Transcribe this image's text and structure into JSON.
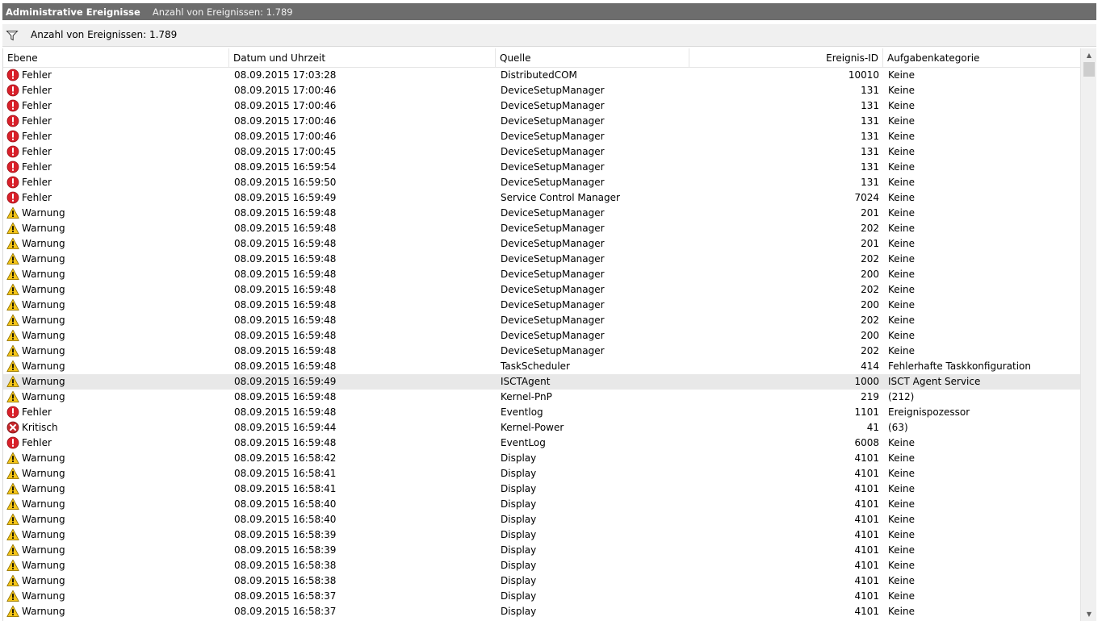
{
  "titlebar": {
    "title": "Administrative Ereignisse",
    "count": "Anzahl von Ereignissen: 1.789"
  },
  "filterbar": {
    "icon": "filter-funnel-icon",
    "text": "Anzahl von Ereignissen: 1.789"
  },
  "columns": {
    "level": "Ebene",
    "date": "Datum und Uhrzeit",
    "source": "Quelle",
    "id": "Ereignis-ID",
    "category": "Aufgabenkategorie"
  },
  "colors": {
    "error": "#d9202a",
    "warning": "#f5c518",
    "critical": "#c5282c",
    "title_band": "#6d6d6d",
    "selected_row": "#e8e8e8"
  },
  "rows": [
    {
      "level": "Fehler",
      "icon": "error",
      "date": "08.09.2015 17:03:28",
      "source": "DistributedCOM",
      "id": "10010",
      "category": "Keine"
    },
    {
      "level": "Fehler",
      "icon": "error",
      "date": "08.09.2015 17:00:46",
      "source": "DeviceSetupManager",
      "id": "131",
      "category": "Keine"
    },
    {
      "level": "Fehler",
      "icon": "error",
      "date": "08.09.2015 17:00:46",
      "source": "DeviceSetupManager",
      "id": "131",
      "category": "Keine"
    },
    {
      "level": "Fehler",
      "icon": "error",
      "date": "08.09.2015 17:00:46",
      "source": "DeviceSetupManager",
      "id": "131",
      "category": "Keine"
    },
    {
      "level": "Fehler",
      "icon": "error",
      "date": "08.09.2015 17:00:46",
      "source": "DeviceSetupManager",
      "id": "131",
      "category": "Keine"
    },
    {
      "level": "Fehler",
      "icon": "error",
      "date": "08.09.2015 17:00:45",
      "source": "DeviceSetupManager",
      "id": "131",
      "category": "Keine"
    },
    {
      "level": "Fehler",
      "icon": "error",
      "date": "08.09.2015 16:59:54",
      "source": "DeviceSetupManager",
      "id": "131",
      "category": "Keine"
    },
    {
      "level": "Fehler",
      "icon": "error",
      "date": "08.09.2015 16:59:50",
      "source": "DeviceSetupManager",
      "id": "131",
      "category": "Keine"
    },
    {
      "level": "Fehler",
      "icon": "error",
      "date": "08.09.2015 16:59:49",
      "source": "Service Control Manager",
      "id": "7024",
      "category": "Keine"
    },
    {
      "level": "Warnung",
      "icon": "warning",
      "date": "08.09.2015 16:59:48",
      "source": "DeviceSetupManager",
      "id": "201",
      "category": "Keine"
    },
    {
      "level": "Warnung",
      "icon": "warning",
      "date": "08.09.2015 16:59:48",
      "source": "DeviceSetupManager",
      "id": "202",
      "category": "Keine"
    },
    {
      "level": "Warnung",
      "icon": "warning",
      "date": "08.09.2015 16:59:48",
      "source": "DeviceSetupManager",
      "id": "201",
      "category": "Keine"
    },
    {
      "level": "Warnung",
      "icon": "warning",
      "date": "08.09.2015 16:59:48",
      "source": "DeviceSetupManager",
      "id": "202",
      "category": "Keine"
    },
    {
      "level": "Warnung",
      "icon": "warning",
      "date": "08.09.2015 16:59:48",
      "source": "DeviceSetupManager",
      "id": "200",
      "category": "Keine"
    },
    {
      "level": "Warnung",
      "icon": "warning",
      "date": "08.09.2015 16:59:48",
      "source": "DeviceSetupManager",
      "id": "202",
      "category": "Keine"
    },
    {
      "level": "Warnung",
      "icon": "warning",
      "date": "08.09.2015 16:59:48",
      "source": "DeviceSetupManager",
      "id": "200",
      "category": "Keine"
    },
    {
      "level": "Warnung",
      "icon": "warning",
      "date": "08.09.2015 16:59:48",
      "source": "DeviceSetupManager",
      "id": "202",
      "category": "Keine"
    },
    {
      "level": "Warnung",
      "icon": "warning",
      "date": "08.09.2015 16:59:48",
      "source": "DeviceSetupManager",
      "id": "200",
      "category": "Keine"
    },
    {
      "level": "Warnung",
      "icon": "warning",
      "date": "08.09.2015 16:59:48",
      "source": "DeviceSetupManager",
      "id": "202",
      "category": "Keine"
    },
    {
      "level": "Warnung",
      "icon": "warning",
      "date": "08.09.2015 16:59:48",
      "source": "TaskScheduler",
      "id": "414",
      "category": "Fehlerhafte Taskkonfiguration"
    },
    {
      "level": "Warnung",
      "icon": "warning",
      "date": "08.09.2015 16:59:49",
      "source": "ISCTAgent",
      "id": "1000",
      "category": "ISCT Agent Service",
      "selected": true
    },
    {
      "level": "Warnung",
      "icon": "warning",
      "date": "08.09.2015 16:59:48",
      "source": "Kernel-PnP",
      "id": "219",
      "category": "(212)"
    },
    {
      "level": "Fehler",
      "icon": "error",
      "date": "08.09.2015 16:59:48",
      "source": "Eventlog",
      "id": "1101",
      "category": "Ereignispozessor"
    },
    {
      "level": "Kritisch",
      "icon": "critical",
      "date": "08.09.2015 16:59:44",
      "source": "Kernel-Power",
      "id": "41",
      "category": "(63)"
    },
    {
      "level": "Fehler",
      "icon": "error",
      "date": "08.09.2015 16:59:48",
      "source": "EventLog",
      "id": "6008",
      "category": "Keine"
    },
    {
      "level": "Warnung",
      "icon": "warning",
      "date": "08.09.2015 16:58:42",
      "source": "Display",
      "id": "4101",
      "category": "Keine"
    },
    {
      "level": "Warnung",
      "icon": "warning",
      "date": "08.09.2015 16:58:41",
      "source": "Display",
      "id": "4101",
      "category": "Keine"
    },
    {
      "level": "Warnung",
      "icon": "warning",
      "date": "08.09.2015 16:58:41",
      "source": "Display",
      "id": "4101",
      "category": "Keine"
    },
    {
      "level": "Warnung",
      "icon": "warning",
      "date": "08.09.2015 16:58:40",
      "source": "Display",
      "id": "4101",
      "category": "Keine"
    },
    {
      "level": "Warnung",
      "icon": "warning",
      "date": "08.09.2015 16:58:40",
      "source": "Display",
      "id": "4101",
      "category": "Keine"
    },
    {
      "level": "Warnung",
      "icon": "warning",
      "date": "08.09.2015 16:58:39",
      "source": "Display",
      "id": "4101",
      "category": "Keine"
    },
    {
      "level": "Warnung",
      "icon": "warning",
      "date": "08.09.2015 16:58:39",
      "source": "Display",
      "id": "4101",
      "category": "Keine"
    },
    {
      "level": "Warnung",
      "icon": "warning",
      "date": "08.09.2015 16:58:38",
      "source": "Display",
      "id": "4101",
      "category": "Keine"
    },
    {
      "level": "Warnung",
      "icon": "warning",
      "date": "08.09.2015 16:58:38",
      "source": "Display",
      "id": "4101",
      "category": "Keine"
    },
    {
      "level": "Warnung",
      "icon": "warning",
      "date": "08.09.2015 16:58:37",
      "source": "Display",
      "id": "4101",
      "category": "Keine"
    },
    {
      "level": "Warnung",
      "icon": "warning",
      "date": "08.09.2015 16:58:37",
      "source": "Display",
      "id": "4101",
      "category": "Keine"
    }
  ]
}
